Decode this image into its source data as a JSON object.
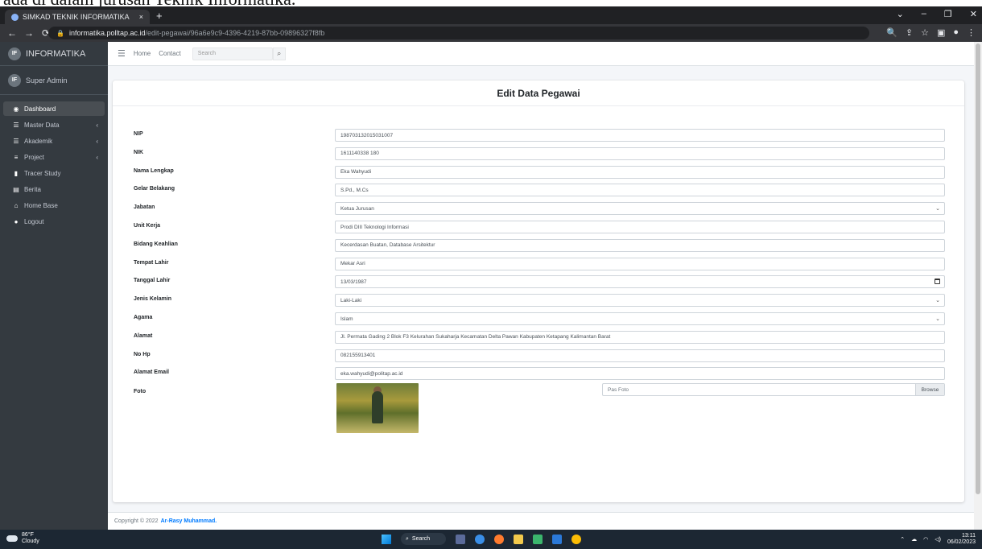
{
  "caption": "ada di dalam jurusan Teknik Informatika.",
  "browser": {
    "tab_title": "SIMKAD TEKNIK INFORMATIKA",
    "tab_close": "×",
    "new_tab": "+",
    "url_host": "informatika.polltap.ac.id",
    "url_path": "/edit-pegawai/96a6e9c9-4396-4219-87bb-09896327f8fb"
  },
  "sidebar": {
    "brand": "INFORMATIKA",
    "brand_logo": "IF",
    "user": "Super Admin",
    "items": [
      {
        "label": "Dashboard",
        "active": true,
        "has_children": false,
        "icon": "dashboard-icon",
        "glyph": "◉"
      },
      {
        "label": "Master Data",
        "active": false,
        "has_children": true,
        "icon": "list-icon",
        "glyph": "☰"
      },
      {
        "label": "Akademik",
        "active": false,
        "has_children": true,
        "icon": "list-icon",
        "glyph": "☰"
      },
      {
        "label": "Project",
        "active": false,
        "has_children": true,
        "icon": "database-icon",
        "glyph": "≡"
      },
      {
        "label": "Tracer Study",
        "active": false,
        "has_children": false,
        "icon": "chart-icon",
        "glyph": "▮"
      },
      {
        "label": "Berita",
        "active": false,
        "has_children": false,
        "icon": "news-icon",
        "glyph": "▤"
      },
      {
        "label": "Home Base",
        "active": false,
        "has_children": false,
        "icon": "home-icon",
        "glyph": "⌂"
      },
      {
        "label": "Logout",
        "active": false,
        "has_children": false,
        "icon": "logout-icon",
        "glyph": "●"
      }
    ],
    "chevron": "‹"
  },
  "topnav": {
    "home": "Home",
    "contact": "Contact",
    "search_placeholder": "Search"
  },
  "form": {
    "title": "Edit Data Pegawai",
    "fields": [
      {
        "label": "NIP",
        "value": "198703132015031007",
        "kind": "text"
      },
      {
        "label": "NIK",
        "value": "1611140338 180",
        "kind": "text"
      },
      {
        "label": "Nama Lengkap",
        "value": "Eka Wahyudi",
        "kind": "text"
      },
      {
        "label": "Gelar Belakang",
        "value": "S.Pd., M.Cs",
        "kind": "text"
      },
      {
        "label": "Jabatan",
        "value": "Ketua Jurusan",
        "kind": "select"
      },
      {
        "label": "Unit Kerja",
        "value": "Prodi DIII Teknologi Informasi",
        "kind": "text"
      },
      {
        "label": "Bidang Keahlian",
        "value": "Kecerdasan Buatan, Database Arsitektur",
        "kind": "text"
      },
      {
        "label": "Tempat Lahir",
        "value": "Mekar Asri",
        "kind": "text"
      },
      {
        "label": "Tanggal Lahir",
        "value": "13/03/1987",
        "kind": "date"
      },
      {
        "label": "Jenis Kelamin",
        "value": "Laki-Laki",
        "kind": "select"
      },
      {
        "label": "Agama",
        "value": "Islam",
        "kind": "select"
      },
      {
        "label": "Alamat",
        "value": "Jl. Permata Gading 2 Blok F3 Kelurahan Sukaharja Kecamatan Delta Pawan Kabupaten Ketapang Kalimantan Barat",
        "kind": "text"
      },
      {
        "label": "No Hp",
        "value": "082155913401",
        "kind": "text"
      },
      {
        "label": "Alamat Email",
        "value": "eka.wahyudi@politap.ac.id",
        "kind": "text"
      }
    ],
    "photo_label": "Foto",
    "file_placeholder": "Pas Foto",
    "browse_label": "Browse",
    "select_arrow": "⌄"
  },
  "footer": {
    "copyright": "Copyright © 2022",
    "author": "Ar-Rasy Muhammad."
  },
  "taskbar": {
    "temp": "86°F",
    "weather": "Cloudy",
    "search": "Search",
    "time": "13:11",
    "date": "06/02/2023"
  }
}
